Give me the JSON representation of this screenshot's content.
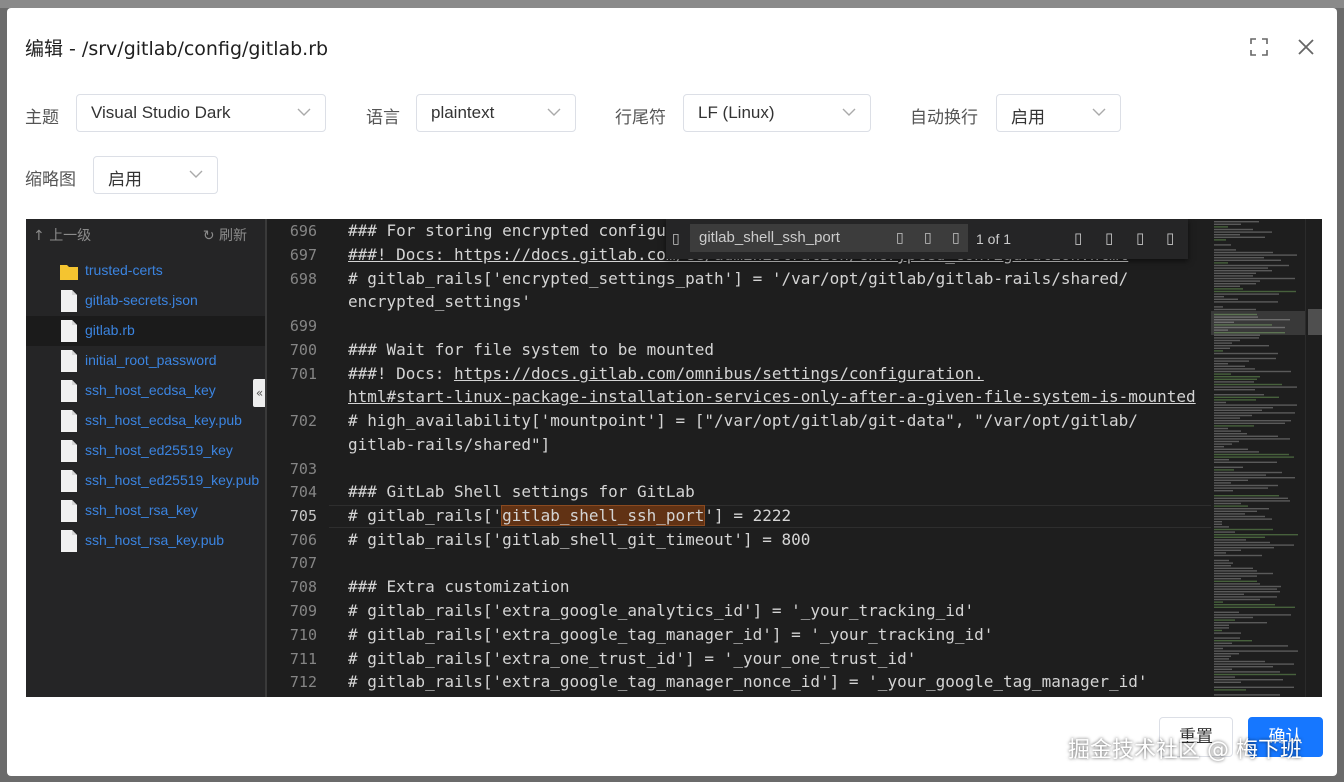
{
  "dialog": {
    "title": "编辑 - /srv/gitlab/config/gitlab.rb"
  },
  "options": {
    "theme_label": "主题",
    "theme_value": "Visual Studio Dark",
    "language_label": "语言",
    "language_value": "plaintext",
    "eol_label": "行尾符",
    "eol_value": "LF (Linux)",
    "wrap_label": "自动换行",
    "wrap_value": "启用",
    "minimap_label": "缩略图",
    "minimap_value": "启用"
  },
  "tree": {
    "up_label": "上一级",
    "refresh_label": "刷新",
    "items": [
      {
        "name": "trusted-certs",
        "type": "folder"
      },
      {
        "name": "gitlab-secrets.json",
        "type": "file"
      },
      {
        "name": "gitlab.rb",
        "type": "file",
        "selected": true
      },
      {
        "name": "initial_root_password",
        "type": "file"
      },
      {
        "name": "ssh_host_ecdsa_key",
        "type": "file"
      },
      {
        "name": "ssh_host_ecdsa_key.pub",
        "type": "file"
      },
      {
        "name": "ssh_host_ed25519_key",
        "type": "file"
      },
      {
        "name": "ssh_host_ed25519_key.pub",
        "type": "file"
      },
      {
        "name": "ssh_host_rsa_key",
        "type": "file"
      },
      {
        "name": "ssh_host_rsa_key.pub",
        "type": "file"
      }
    ]
  },
  "find": {
    "query": "gitlab_shell_ssh_port",
    "count": "1 of 1"
  },
  "code": {
    "gutter": [
      "696",
      "697",
      "698",
      "699",
      "700",
      "701",
      "702",
      "703",
      "704",
      "705",
      "706",
      "707",
      "708",
      "709",
      "710",
      "711",
      "712"
    ],
    "lines": {
      "l696": "### For storing encrypted configu",
      "l697": "###! Docs: https://docs.gitlab.com/ee/administration/encrypted_configuration.html",
      "l698a": "# gitlab_rails['encrypted_settings_path'] = '/var/opt/gitlab/gitlab-rails/shared/",
      "l698b": "encrypted_settings'",
      "l700": "### Wait for file system to be mounted",
      "l701a_pre": "###! Docs: ",
      "l701a_link": "https://docs.gitlab.com/omnibus/settings/configuration.",
      "l701b": "html#start-linux-package-installation-services-only-after-a-given-file-system-is-mounted",
      "l702a": "# high_availability['mountpoint'] = [\"/var/opt/gitlab/git-data\", \"/var/opt/gitlab/",
      "l702b": "gitlab-rails/shared\"]",
      "l704": "### GitLab Shell settings for GitLab",
      "l705_pre": "# gitlab_rails['",
      "l705_match": "gitlab_shell_ssh_port",
      "l705_post": "'] = 2222",
      "l706": "# gitlab_rails['gitlab_shell_git_timeout'] = 800",
      "l708": "### Extra customization",
      "l709": "# gitlab_rails['extra_google_analytics_id'] = '_your_tracking_id'",
      "l710": "# gitlab_rails['extra_google_tag_manager_id'] = '_your_tracking_id'",
      "l711": "# gitlab_rails['extra_one_trust_id'] = '_your_one_trust_id'",
      "l712": "# gitlab_rails['extra_google_tag_manager_nonce_id'] = '_your_google_tag_manager_id'"
    }
  },
  "footer": {
    "reset_label": "重置",
    "ok_label": "确认",
    "watermark": "掘金技术社区 @ 梅下班"
  },
  "colors": {
    "primary": "#1677ff",
    "editor_bg": "#1e1e1e",
    "tree_link": "#3b84e0",
    "match_bg": "#613214",
    "folder": "#f4c430"
  }
}
